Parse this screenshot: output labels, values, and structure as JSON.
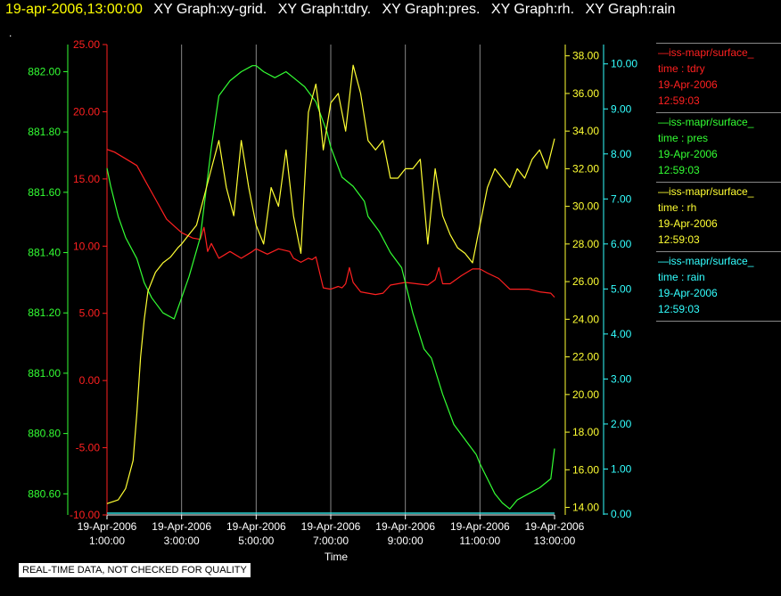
{
  "header": {
    "timestamp": "19-apr-2006,13:00:00",
    "graphs": [
      "XY Graph:xy-grid.",
      "XY Graph:tdry.",
      "XY Graph:pres.",
      "XY Graph:rh.",
      "XY Graph:rain"
    ]
  },
  "stray_mark": ".",
  "footer": {
    "notice": "REAL-TIME DATA, NOT CHECKED FOR QUALITY"
  },
  "legend": [
    {
      "name": "—iss-mapr/surface_",
      "var": "time : tdry",
      "date": "19-Apr-2006",
      "time": "12:59:03",
      "color": "#ff2020"
    },
    {
      "name": "—iss-mapr/surface_",
      "var": "time : pres",
      "date": "19-Apr-2006",
      "time": "12:59:03",
      "color": "#33ff33"
    },
    {
      "name": "—iss-mapr/surface_",
      "var": "time : rh",
      "date": "19-Apr-2006",
      "time": "12:59:03",
      "color": "#ffff33"
    },
    {
      "name": "—iss-mapr/surface_",
      "var": "time : rain",
      "date": "19-Apr-2006",
      "time": "12:59:03",
      "color": "#33ffff"
    }
  ],
  "chart_data": {
    "type": "line",
    "xlabel": "Time",
    "x_ticks": [
      {
        "t": 1,
        "l1": "19-Apr-2006",
        "l2": "1:00:00"
      },
      {
        "t": 3,
        "l1": "19-Apr-2006",
        "l2": "3:00:00"
      },
      {
        "t": 5,
        "l1": "19-Apr-2006",
        "l2": "5:00:00"
      },
      {
        "t": 7,
        "l1": "19-Apr-2006",
        "l2": "7:00:00"
      },
      {
        "t": 9,
        "l1": "19-Apr-2006",
        "l2": "9:00:00"
      },
      {
        "t": 11,
        "l1": "19-Apr-2006",
        "l2": "11:00:00"
      },
      {
        "t": 13,
        "l1": "19-Apr-2006",
        "l2": "13:00:00"
      }
    ],
    "xlim": [
      1,
      13
    ],
    "grid": "vertical",
    "axes": {
      "pres": {
        "color": "#33ff33",
        "ylim": [
          880.53,
          882.09
        ],
        "ticks": [
          "880.60",
          "880.80",
          "881.00",
          "881.20",
          "881.40",
          "881.60",
          "881.80",
          "882.00"
        ]
      },
      "tdry": {
        "color": "#ff2020",
        "ylim": [
          -10,
          25
        ],
        "ticks": [
          "-10.00",
          "-5.00",
          "0.00",
          "5.00",
          "10.00",
          "15.00",
          "20.00",
          "25.00"
        ]
      },
      "rh": {
        "color": "#ffff33",
        "ylim": [
          13.6,
          38.6
        ],
        "ticks": [
          "14.00",
          "16.00",
          "18.00",
          "20.00",
          "22.00",
          "24.00",
          "26.00",
          "28.00",
          "30.00",
          "32.00",
          "34.00",
          "36.00",
          "38.00"
        ]
      },
      "rain": {
        "color": "#33ffff",
        "ylim": [
          -0.02,
          10.43
        ],
        "ticks": [
          "0.00",
          "1.00",
          "2.00",
          "3.00",
          "4.00",
          "5.00",
          "6.00",
          "7.00",
          "8.00",
          "9.00",
          "10.00"
        ]
      }
    },
    "series": [
      {
        "name": "tdry",
        "axis": "tdry",
        "color": "#ff2020",
        "x": [
          1,
          1.2,
          1.5,
          1.8,
          2,
          2.3,
          2.6,
          3,
          3.3,
          3.5,
          3.6,
          3.7,
          3.8,
          4,
          4.3,
          4.6,
          4.9,
          5,
          5.3,
          5.6,
          5.9,
          6,
          6.2,
          6.4,
          6.5,
          6.6,
          6.8,
          7,
          7.2,
          7.3,
          7.4,
          7.5,
          7.6,
          7.8,
          8,
          8.2,
          8.4,
          8.6,
          8.8,
          9,
          9.3,
          9.6,
          9.8,
          9.9,
          10,
          10.2,
          10.5,
          10.8,
          11,
          11.2,
          11.5,
          11.8,
          12,
          12.3,
          12.6,
          12.9,
          13
        ],
        "y": [
          17.2,
          17.0,
          16.5,
          16.0,
          15.0,
          13.5,
          12.0,
          11.0,
          10.6,
          10.5,
          11.4,
          9.6,
          10.2,
          9.1,
          9.6,
          9.1,
          9.6,
          9.8,
          9.4,
          9.8,
          9.6,
          9.1,
          8.8,
          9.1,
          9.0,
          9.2,
          6.9,
          6.8,
          7.0,
          6.9,
          7.2,
          8.4,
          7.3,
          6.6,
          6.5,
          6.4,
          6.5,
          7.1,
          7.2,
          7.3,
          7.2,
          7.1,
          7.5,
          8.4,
          7.2,
          7.2,
          7.8,
          8.3,
          8.3,
          8.0,
          7.6,
          6.8,
          6.8,
          6.8,
          6.6,
          6.5,
          6.2
        ]
      },
      {
        "name": "pres",
        "axis": "pres",
        "color": "#33ff33",
        "x": [
          1,
          1.1,
          1.3,
          1.5,
          1.8,
          2,
          2.2,
          2.5,
          2.8,
          3,
          3.2,
          3.5,
          3.8,
          4,
          4.3,
          4.6,
          4.9,
          5,
          5.2,
          5.5,
          5.8,
          6,
          6.3,
          6.6,
          6.9,
          7,
          7.3,
          7.6,
          7.9,
          8,
          8.3,
          8.6,
          8.9,
          9,
          9.2,
          9.4,
          9.5,
          9.7,
          10,
          10.3,
          10.6,
          10.9,
          11,
          11.2,
          11.4,
          11.6,
          11.8,
          12,
          12.3,
          12.6,
          12.9,
          13
        ],
        "y": [
          881.68,
          881.62,
          881.52,
          881.45,
          881.38,
          881.3,
          881.25,
          881.2,
          881.18,
          881.25,
          881.32,
          881.45,
          881.75,
          881.92,
          881.97,
          882.0,
          882.02,
          882.02,
          882.0,
          881.98,
          882.0,
          881.98,
          881.95,
          881.9,
          881.8,
          881.75,
          881.65,
          881.62,
          881.57,
          881.52,
          881.47,
          881.4,
          881.35,
          881.3,
          881.2,
          881.12,
          881.08,
          881.05,
          880.93,
          880.83,
          880.78,
          880.73,
          880.7,
          880.65,
          880.6,
          880.57,
          880.55,
          880.58,
          880.6,
          880.62,
          880.65,
          880.75
        ]
      },
      {
        "name": "rh",
        "axis": "rh",
        "color": "#ffff33",
        "x": [
          1,
          1.3,
          1.5,
          1.7,
          1.8,
          1.9,
          2,
          2.1,
          2.2,
          2.3,
          2.5,
          2.7,
          2.9,
          3,
          3.2,
          3.4,
          3.6,
          3.8,
          4,
          4.2,
          4.4,
          4.6,
          4.8,
          5,
          5.2,
          5.4,
          5.6,
          5.8,
          6,
          6.2,
          6.4,
          6.6,
          6.7,
          6.8,
          7,
          7.2,
          7.4,
          7.6,
          7.8,
          8,
          8.2,
          8.4,
          8.6,
          8.8,
          9,
          9.2,
          9.4,
          9.6,
          9.8,
          10,
          10.2,
          10.4,
          10.6,
          10.8,
          11,
          11.2,
          11.4,
          11.6,
          11.8,
          12,
          12.2,
          12.4,
          12.6,
          12.8,
          13
        ],
        "y": [
          14.2,
          14.4,
          15.0,
          16.5,
          19.0,
          22.0,
          24.0,
          25.5,
          26.0,
          26.5,
          27.0,
          27.3,
          27.8,
          28.0,
          28.5,
          29.0,
          30.5,
          32.0,
          33.5,
          31.0,
          29.5,
          33.5,
          31.0,
          29.0,
          28.0,
          31.0,
          30.0,
          33.0,
          29.5,
          27.5,
          35.0,
          36.5,
          35.0,
          33.0,
          35.5,
          36.0,
          34.0,
          37.5,
          36.0,
          33.5,
          33.0,
          33.5,
          31.5,
          31.5,
          32.0,
          32.0,
          32.5,
          28.0,
          32.0,
          29.5,
          28.5,
          27.8,
          27.5,
          27.0,
          29.0,
          31.0,
          32.0,
          31.5,
          31.0,
          32.0,
          31.5,
          32.5,
          33.0,
          32.0,
          33.6
        ]
      },
      {
        "name": "rain",
        "axis": "rain",
        "color": "#33ffff",
        "x": [
          1,
          13
        ],
        "y": [
          0.02,
          0.02
        ]
      }
    ]
  }
}
